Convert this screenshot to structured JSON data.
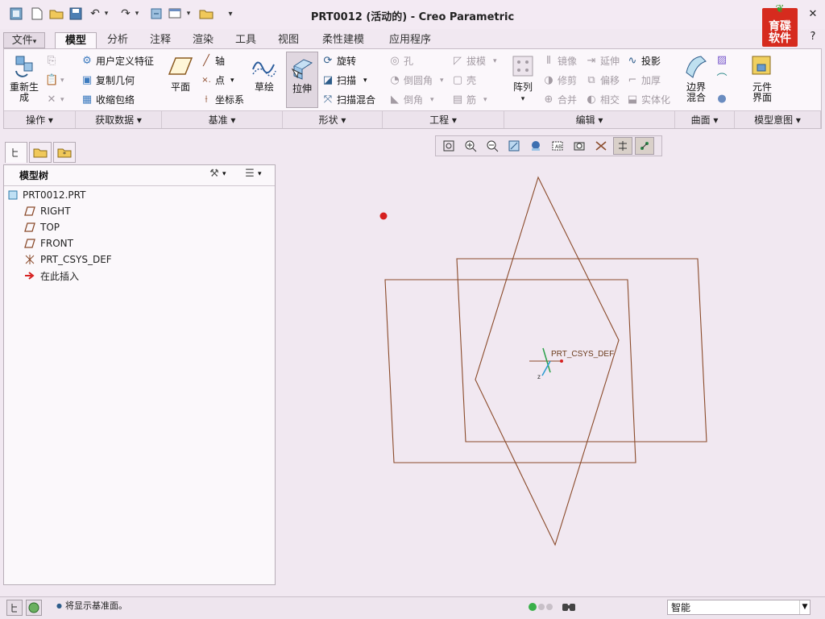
{
  "window": {
    "title": "PRT0012 (活动的) - Creo Parametric"
  },
  "logo": {
    "text_line1": "育碟",
    "text_line2": "软件"
  },
  "tabs": [
    {
      "label": "文件",
      "arrow": "▾"
    },
    {
      "label": "模型"
    },
    {
      "label": "分析"
    },
    {
      "label": "注释"
    },
    {
      "label": "渲染"
    },
    {
      "label": "工具"
    },
    {
      "label": "视图"
    },
    {
      "label": "柔性建模"
    },
    {
      "label": "应用程序"
    }
  ],
  "ribbon": {
    "operations": {
      "regenerate": "重新生成",
      "footer": "操作"
    },
    "get_data": {
      "udf": "用户定义特征",
      "copy_geom": "复制几何",
      "shrinkwrap": "收缩包络",
      "footer": "获取数据"
    },
    "datum": {
      "plane": "平面",
      "axis": "轴",
      "point": "点",
      "csys": "坐标系",
      "sketch": "草绘",
      "footer": "基准"
    },
    "shapes": {
      "extrude": "拉伸",
      "revolve": "旋转",
      "sweep": "扫描",
      "swept_blend": "扫描混合",
      "footer": "形状"
    },
    "engineering": {
      "hole": "孔",
      "round": "倒圆角",
      "chamfer": "倒角",
      "draft": "拔模",
      "shell": "壳",
      "rib": "筋",
      "footer": "工程"
    },
    "editing": {
      "pattern": "阵列",
      "mirror": "镜像",
      "trim": "修剪",
      "merge": "合并",
      "extend": "延伸",
      "offset": "偏移",
      "intersect": "相交",
      "project": "投影",
      "thicken": "加厚",
      "solidify": "实体化",
      "footer": "编辑"
    },
    "surfaces": {
      "boundary_blend": "边界混合",
      "footer": "曲面"
    },
    "intent": {
      "component_interface": "元件界面",
      "footer": "模型意图"
    }
  },
  "model_tree": {
    "title": "模型树",
    "items": [
      {
        "label": "PRT0012.PRT",
        "icon": "part-icon"
      },
      {
        "label": "RIGHT",
        "icon": "datum-plane-icon"
      },
      {
        "label": "TOP",
        "icon": "datum-plane-icon"
      },
      {
        "label": "FRONT",
        "icon": "datum-plane-icon"
      },
      {
        "label": "PRT_CSYS_DEF",
        "icon": "csys-icon"
      },
      {
        "label": "在此插入",
        "icon": "insert-arrow-icon"
      }
    ]
  },
  "graphics": {
    "csys_label": "PRT_CSYS_DEF",
    "axis_label": "z"
  },
  "status": {
    "message": "将显示基准面。",
    "filter_value": "智能"
  },
  "colors": {
    "datum_plane": "#8a4a2a",
    "accent_red": "#d62020",
    "bg": "#f1e8f1"
  }
}
